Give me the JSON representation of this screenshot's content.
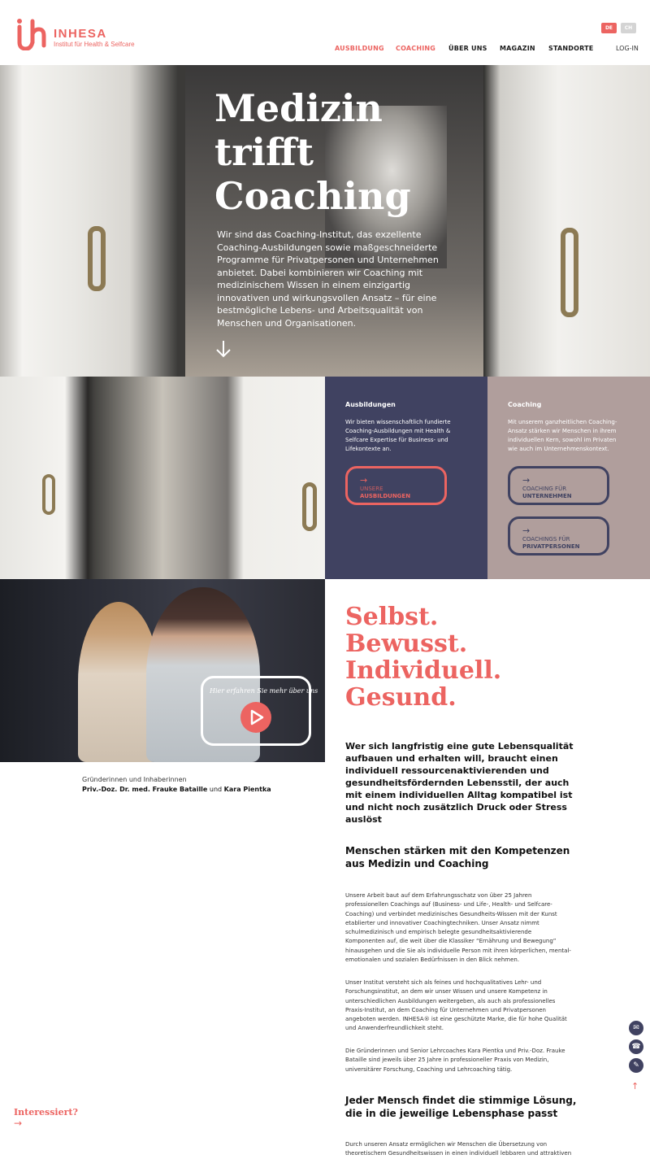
{
  "brand": {
    "name": "INHESA",
    "subtitle": "Institut für Health & Selfcare",
    "color": "#ec6461"
  },
  "lang": {
    "de": "DE",
    "ch": "CH"
  },
  "nav": {
    "items": [
      {
        "label": "AUSBILDUNG",
        "active": true
      },
      {
        "label": "COACHING",
        "active": true
      },
      {
        "label": "ÜBER UNS"
      },
      {
        "label": "MAGAZIN"
      },
      {
        "label": "STANDORTE"
      }
    ],
    "login": "LOG-IN"
  },
  "hero": {
    "title": "Medizin\ntrifft\nCoaching",
    "text": "Wir sind das Coaching-Institut, das exzellente Coaching-Ausbildungen sowie maßgeschneiderte Programme für Privatpersonen und Unternehmen anbietet. Dabei kombinieren wir Coaching mit medizinischem Wissen in einem einzigartig innovativen und wirkungsvollen Ansatz – für eine bestmögliche Lebens- und Arbeitsqualität von Menschen und Organisationen."
  },
  "panels": {
    "ausbildungen": {
      "title": "Ausbildungen",
      "text": "Wir bieten wissenschaftlich fundierte Coaching-Ausbildungen mit Health & Selfcare Expertise für Business- und Lifekontexte an.",
      "button": {
        "line1": "UNSERE",
        "line2": "AUSBILDUNGEN"
      }
    },
    "coaching": {
      "title": "Coaching",
      "text": "Mit unserem ganzheitlichen Coaching-Ansatz stärken wir Menschen in ihrem individuellen Kern, sowohl im Privaten wie auch im Unternehmenskontext.",
      "button1": {
        "line1": "COACHING FÜR",
        "line2": "UNTERNEHMEN"
      },
      "button2": {
        "line1": "COACHINGS FÜR",
        "line2": "PRIVATPERSONEN"
      }
    }
  },
  "video": {
    "caption": "Hier erfahren Sie mehr über uns"
  },
  "founders": {
    "line1": "Gründerinnen und Inhaberinnen",
    "name1": "Priv.-Doz. Dr. med. Frauke Bataille",
    "and": " und ",
    "name2": "Kara Pientka"
  },
  "slogan": "Selbst.\nBewusst.\nIndividuell.\nGesund.",
  "lead": "Wer sich langfristig eine gute Lebensqualität aufbauen und erhalten will, braucht einen individuell ressourcenaktivierenden und gesundheitsfördernden Lebensstil, der auch mit einem individuellen Alltag kompatibel ist und nicht noch zusätzlich Druck oder Stress auslöst",
  "section1": {
    "heading": "Menschen stärken mit den Kompetenzen aus Medizin und Coaching",
    "p1": "Unsere Arbeit baut auf dem Erfahrungsschatz von über 25 Jahren professionellen Coachings auf (Business- und Life-, Health- und Selfcare-Coaching) und verbindet medizinisches Gesundheits-Wissen mit der Kunst etablierter und innovativer Coachingtechniken. Unser Ansatz nimmt schulmedizinisch und empirisch belegte gesundheitsaktivierende Komponenten auf, die weit über die Klassiker “Ernährung und Bewegung” hinausgehen und die Sie als individuelle Person mit ihren körperlichen, mental-emotionalen und sozialen Bedürfnissen in den Blick nehmen.",
    "p2": "Unser Institut versteht sich als feines und hochqualitatives Lehr- und Forschungsinstitut, an dem wir unser Wissen und unsere Kompetenz in unterschiedlichen Ausbildungen weitergeben, als auch als professionelles Praxis-Institut, an dem Coaching für Unternehmen und Privatpersonen angeboten werden. INHESA® ist eine geschützte Marke, die für hohe Qualität und Anwenderfreundlichkeit steht.",
    "p3": "Die Gründerinnen und Senior Lehrcoaches Kara Pientka und Priv.-Doz. Frauke Bataille sind jeweils über 25 Jahre in professioneller Praxis von Medizin, universitärer Forschung, Coaching und Lehrcoaching tätig."
  },
  "section2": {
    "heading": "Jeder Mensch findet die stimmige Lösung, die in die jeweilige Lebensphase passt",
    "p1": "Durch unseren Ansatz ermöglichen wir Menschen die Übersetzung von theoretischem Gesundheitswissen in einen individuell lebbaren und attraktiven"
  },
  "cta": {
    "label": "Interessiert?"
  },
  "side_icons": [
    "mail-icon",
    "phone-icon",
    "chat-icon",
    "arrow-up-icon"
  ]
}
